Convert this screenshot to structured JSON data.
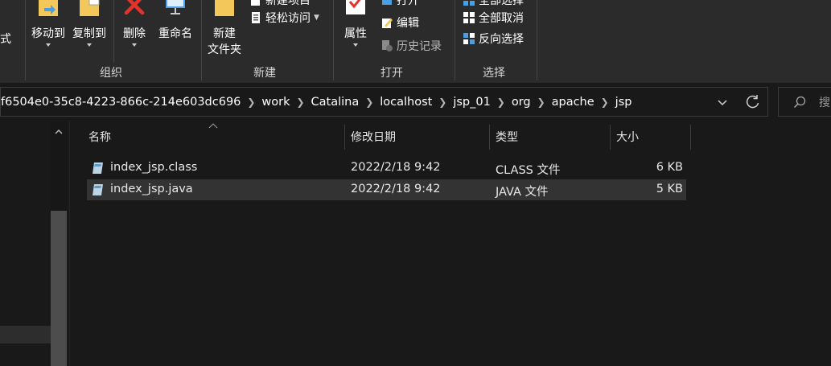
{
  "ribbon": {
    "partial_left_label": "式",
    "move_to": "移动到",
    "copy_to": "复制到",
    "delete": "删除",
    "rename": "重命名",
    "new_folder_line1": "新建",
    "new_folder_line2": "文件夹",
    "new_item": "新建项目",
    "easy_access": "轻松访问",
    "properties": "属性",
    "open": "打开",
    "edit": "编辑",
    "history": "历史记录",
    "select_all": "全部选择",
    "select_none": "全部取消",
    "invert_selection": "反向选择",
    "group_organize": "组织",
    "group_new": "新建",
    "group_open": "打开",
    "group_select": "选择"
  },
  "address": {
    "crumbs": [
      "f6504e0-35c8-4223-866c-214e603dc696",
      "work",
      "Catalina",
      "localhost",
      "jsp_01",
      "org",
      "apache",
      "jsp"
    ],
    "search_placeholder": "搜"
  },
  "columns": {
    "name": "名称",
    "modified": "修改日期",
    "type": "类型",
    "size": "大小"
  },
  "files": [
    {
      "name": "index_jsp.class",
      "modified": "2022/2/18 9:42",
      "type": "CLASS 文件",
      "size": "6 KB",
      "selected": false
    },
    {
      "name": "index_jsp.java",
      "modified": "2022/2/18 9:42",
      "type": "JAVA 文件",
      "size": "5 KB",
      "selected": true
    }
  ],
  "colors": {
    "ribbon_bg": "#2b2b2b",
    "window_bg": "#191919",
    "selected_row": "#333333",
    "folder_yellow": "#f3c75a",
    "accent_blue": "#4aa0e6",
    "delete_red": "#e5322d"
  },
  "icons": {
    "move_to": "folder-arrow-icon",
    "copy_to": "folder-copy-icon",
    "delete": "red-x-icon",
    "rename": "rename-icon",
    "new_folder": "new-folder-icon",
    "properties": "checkmark-properties-icon",
    "file": "generic-file-icon"
  }
}
